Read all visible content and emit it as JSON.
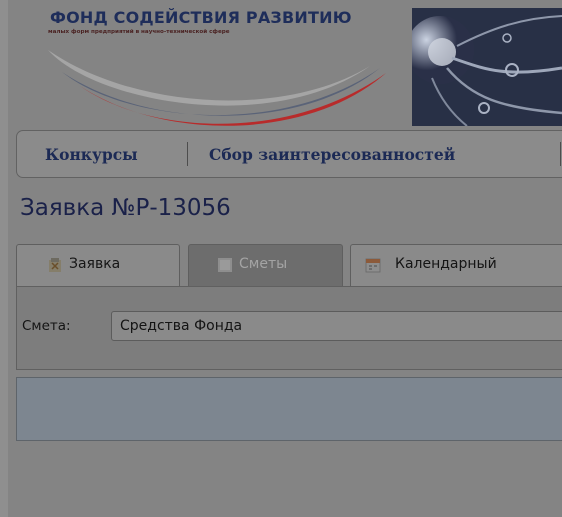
{
  "header": {
    "org_name": "ФОНД СОДЕЙСТВИЯ РАЗВИТИЮ",
    "org_subtitle": "малых форм предприятий в научно-технической сфере",
    "logo_icon": "flag-swoosh-logo",
    "banner_icon": "neuron-banner-image"
  },
  "nav": {
    "items": [
      {
        "label": "Конкурсы"
      },
      {
        "label": "Сбор заинтересованностей"
      }
    ]
  },
  "page": {
    "title": "Заявка №Р-13056"
  },
  "tabs": [
    {
      "label": "Заявка",
      "icon": "application-icon",
      "active": false
    },
    {
      "label": "Сметы",
      "icon": "estimates-icon",
      "active": true
    },
    {
      "label": "Календарный",
      "icon": "calendar-icon",
      "active": false
    }
  ],
  "estimate": {
    "label": "Смета:",
    "selected": "Средства Фонда"
  },
  "colors": {
    "overlay_bg": "#848484",
    "title_text": "#1a2149",
    "nav_text": "#1c2a55"
  }
}
